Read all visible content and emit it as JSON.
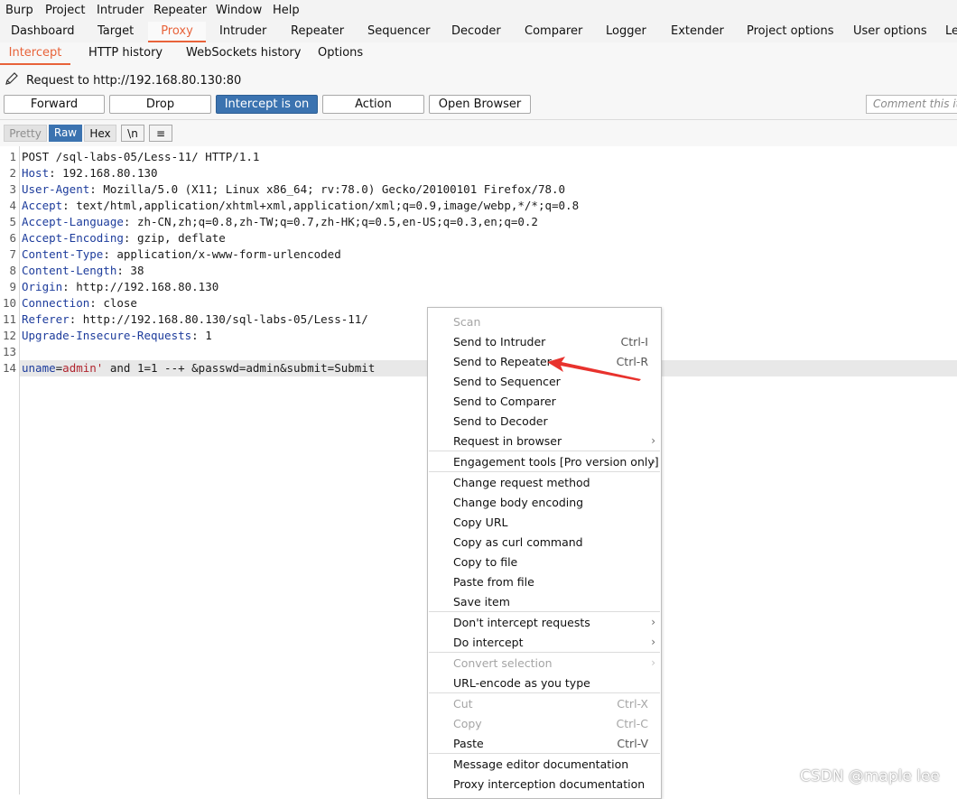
{
  "menubar": [
    "Burp",
    "Project",
    "Intruder",
    "Repeater",
    "Window",
    "Help"
  ],
  "main_tabs": [
    "Dashboard",
    "Target",
    "Proxy",
    "Intruder",
    "Repeater",
    "Sequencer",
    "Decoder",
    "Comparer",
    "Logger",
    "Extender",
    "Project options",
    "User options",
    "Le"
  ],
  "main_tab_active": "Proxy",
  "sub_tabs": [
    "Intercept",
    "HTTP history",
    "WebSockets history",
    "Options"
  ],
  "sub_tab_active": "Intercept",
  "request_label": "Request to http://192.168.80.130:80",
  "toolbar": {
    "forward": "Forward",
    "drop": "Drop",
    "intercept": "Intercept is on",
    "action": "Action",
    "open_browser": "Open Browser",
    "comment_placeholder": "Comment this it"
  },
  "view_buttons": {
    "pretty": "Pretty",
    "raw": "Raw",
    "hex": "Hex",
    "newline": "\\n",
    "menu": "≡"
  },
  "request_lines": [
    {
      "n": "1",
      "name": "",
      "value": "POST /sql-labs-05/Less-11/ HTTP/1.1"
    },
    {
      "n": "2",
      "name": "Host",
      "value": " 192.168.80.130"
    },
    {
      "n": "3",
      "name": "User-Agent",
      "value": " Mozilla/5.0 (X11; Linux x86_64; rv:78.0) Gecko/20100101 Firefox/78.0"
    },
    {
      "n": "4",
      "name": "Accept",
      "value": " text/html,application/xhtml+xml,application/xml;q=0.9,image/webp,*/*;q=0.8"
    },
    {
      "n": "5",
      "name": "Accept-Language",
      "value": " zh-CN,zh;q=0.8,zh-TW;q=0.7,zh-HK;q=0.5,en-US;q=0.3,en;q=0.2"
    },
    {
      "n": "6",
      "name": "Accept-Encoding",
      "value": " gzip, deflate"
    },
    {
      "n": "7",
      "name": "Content-Type",
      "value": " application/x-www-form-urlencoded"
    },
    {
      "n": "8",
      "name": "Content-Length",
      "value": " 38"
    },
    {
      "n": "9",
      "name": "Origin",
      "value": " http://192.168.80.130"
    },
    {
      "n": "10",
      "name": "Connection",
      "value": " close"
    },
    {
      "n": "11",
      "name": "Referer",
      "value": " http://192.168.80.130/sql-labs-05/Less-11/"
    },
    {
      "n": "12",
      "name": "Upgrade-Insecure-Requests",
      "value": " 1"
    },
    {
      "n": "13",
      "name": "",
      "value": ""
    }
  ],
  "body_line": {
    "n": "14",
    "key": "uname",
    "eq": "=",
    "val": "admin'",
    "rest": " and 1=1 --+ &passwd=admin&submit=Submit"
  },
  "context_menu": [
    {
      "label": "Scan",
      "shortcut": "",
      "disabled": true,
      "submenu": false
    },
    {
      "label": "Send to Intruder",
      "shortcut": "Ctrl-I",
      "disabled": false,
      "submenu": false
    },
    {
      "label": "Send to Repeater",
      "shortcut": "Ctrl-R",
      "disabled": false,
      "submenu": false
    },
    {
      "label": "Send to Sequencer",
      "shortcut": "",
      "disabled": false,
      "submenu": false
    },
    {
      "label": "Send to Comparer",
      "shortcut": "",
      "disabled": false,
      "submenu": false
    },
    {
      "label": "Send to Decoder",
      "shortcut": "",
      "disabled": false,
      "submenu": false
    },
    {
      "label": "Request in browser",
      "shortcut": "",
      "disabled": false,
      "submenu": true
    },
    {
      "label": "Engagement tools [Pro version only]",
      "shortcut": "",
      "disabled": false,
      "submenu": true
    },
    {
      "label": "Change request method",
      "shortcut": "",
      "disabled": false,
      "submenu": false
    },
    {
      "label": "Change body encoding",
      "shortcut": "",
      "disabled": false,
      "submenu": false
    },
    {
      "label": "Copy URL",
      "shortcut": "",
      "disabled": false,
      "submenu": false
    },
    {
      "label": "Copy as curl command",
      "shortcut": "",
      "disabled": false,
      "submenu": false
    },
    {
      "label": "Copy to file",
      "shortcut": "",
      "disabled": false,
      "submenu": false
    },
    {
      "label": "Paste from file",
      "shortcut": "",
      "disabled": false,
      "submenu": false
    },
    {
      "label": "Save item",
      "shortcut": "",
      "disabled": false,
      "submenu": false
    },
    {
      "label": "Don't intercept requests",
      "shortcut": "",
      "disabled": false,
      "submenu": true
    },
    {
      "label": "Do intercept",
      "shortcut": "",
      "disabled": false,
      "submenu": true
    },
    {
      "label": "Convert selection",
      "shortcut": "",
      "disabled": true,
      "submenu": true
    },
    {
      "label": "URL-encode as you type",
      "shortcut": "",
      "disabled": false,
      "submenu": false
    },
    {
      "label": "Cut",
      "shortcut": "Ctrl-X",
      "disabled": true,
      "submenu": false
    },
    {
      "label": "Copy",
      "shortcut": "Ctrl-C",
      "disabled": true,
      "submenu": false
    },
    {
      "label": "Paste",
      "shortcut": "Ctrl-V",
      "disabled": false,
      "submenu": false
    },
    {
      "label": "Message editor documentation",
      "shortcut": "",
      "disabled": false,
      "submenu": false
    },
    {
      "label": "Proxy interception documentation",
      "shortcut": "",
      "disabled": false,
      "submenu": false
    }
  ],
  "colors": {
    "accent": "#e8633a",
    "intercept_on": "#3b73b0",
    "arrow": "#e8322d"
  },
  "watermark": "CSDN @maple lee"
}
